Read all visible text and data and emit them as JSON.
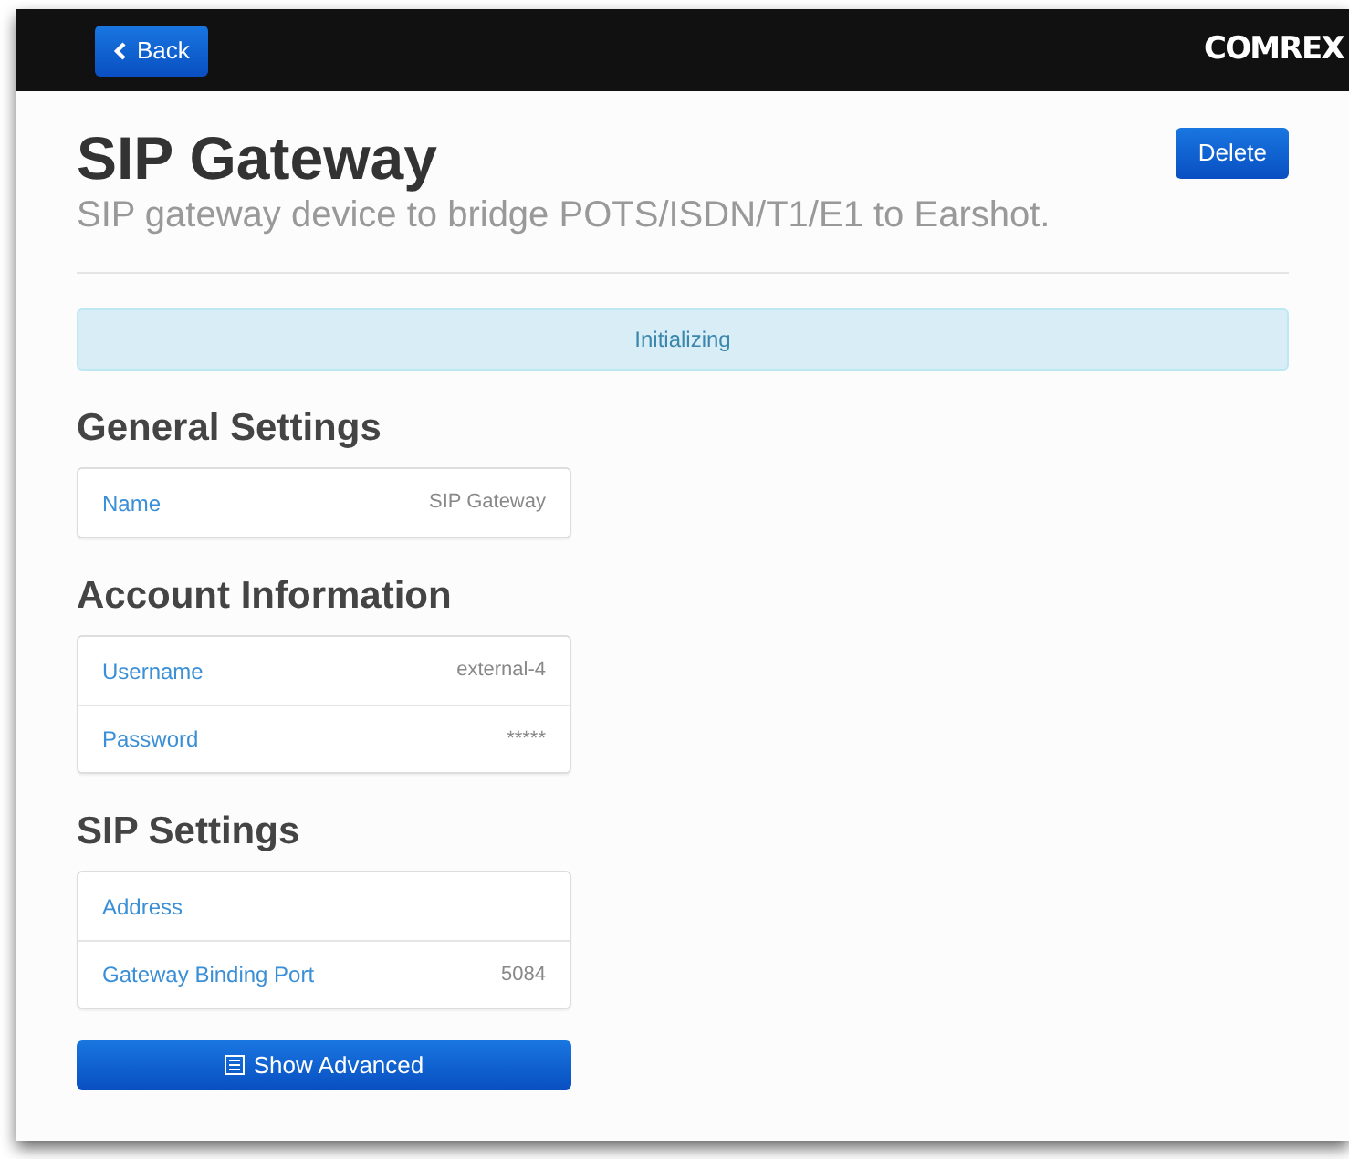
{
  "navbar": {
    "back_button": "Back",
    "logo": "COMREX"
  },
  "header": {
    "title": "SIP Gateway",
    "subtitle": "SIP gateway device to bridge POTS/ISDN/T1/E1 to Earshot.",
    "delete_button": "Delete"
  },
  "status_alert": "Initializing",
  "sections": [
    {
      "title": "General Settings",
      "rows": [
        {
          "label": "Name",
          "value": "SIP Gateway"
        }
      ]
    },
    {
      "title": "Account Information",
      "rows": [
        {
          "label": "Username",
          "value": "external-4"
        },
        {
          "label": "Password",
          "value": "*****"
        }
      ]
    },
    {
      "title": "SIP Settings",
      "rows": [
        {
          "label": "Address"
        },
        {
          "label": "Gateway Binding Port",
          "value": "5084"
        }
      ]
    }
  ],
  "advanced_button": "Show Advanced"
}
